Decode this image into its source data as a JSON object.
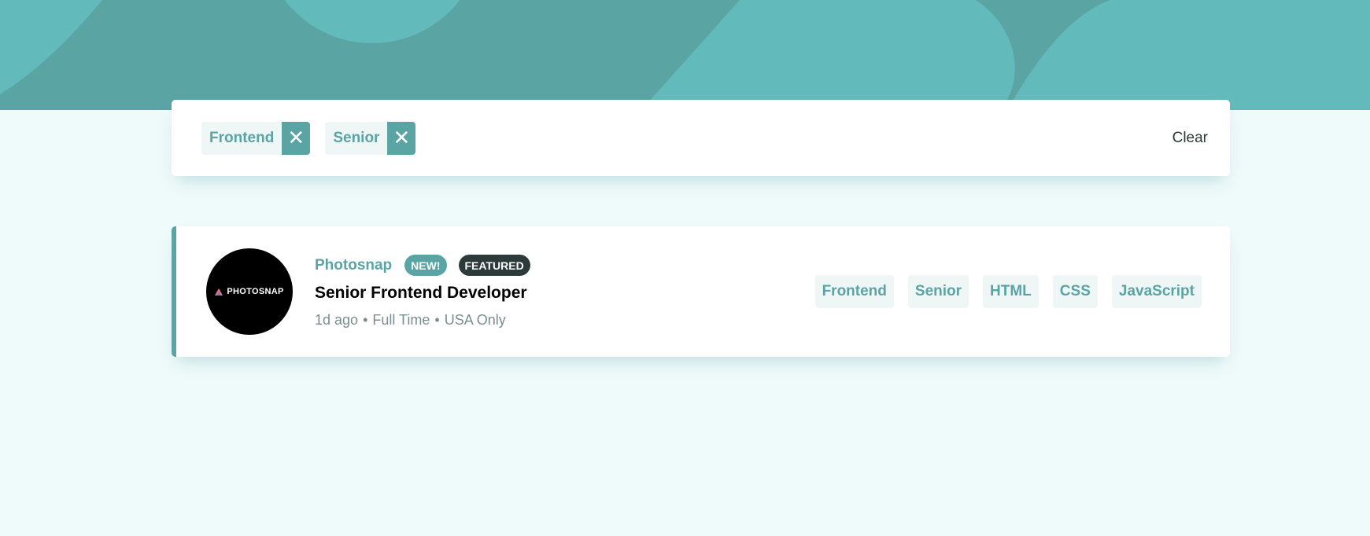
{
  "colors": {
    "primary": "#5ba4a4",
    "background": "#effafa",
    "dark": "#2c3a3a",
    "muted": "#7b8e8e",
    "tag_bg": "#eef6f6"
  },
  "filters": {
    "chips": [
      {
        "label": "Frontend",
        "remove_icon": "close-icon"
      },
      {
        "label": "Senior",
        "remove_icon": "close-icon"
      }
    ],
    "clear_label": "Clear"
  },
  "jobs": [
    {
      "logo_text": "PHOTOSNAP",
      "company": "Photosnap",
      "badge_new": "NEW!",
      "badge_featured": "FEATURED",
      "position": "Senior Frontend Developer",
      "posted": "1d ago",
      "separator": "•",
      "contract": "Full Time",
      "location": "USA Only",
      "tags": [
        "Frontend",
        "Senior",
        "HTML",
        "CSS",
        "JavaScript"
      ]
    }
  ]
}
